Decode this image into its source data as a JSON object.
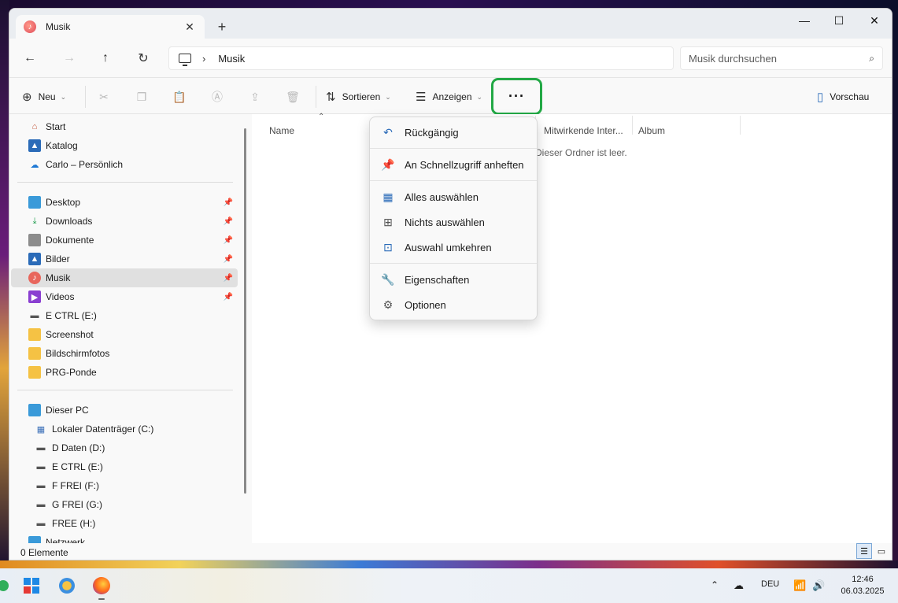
{
  "window": {
    "tab_title": "Musik",
    "new_tab": "+",
    "minimize": "—",
    "maximize": "☐",
    "close": "✕"
  },
  "nav": {
    "back": "←",
    "forward": "→",
    "up": "↑",
    "refresh": "↻",
    "breadcrumb": "Musik",
    "search_placeholder": "Musik durchsuchen"
  },
  "toolbar": {
    "new_label": "Neu",
    "sort_label": "Sortieren",
    "view_label": "Anzeigen",
    "more_label": "···",
    "preview_label": "Vorschau"
  },
  "sidebar": {
    "quick": [
      {
        "label": "Start"
      },
      {
        "label": "Katalog"
      },
      {
        "label": "Carlo – Persönlich"
      }
    ],
    "pinned": [
      {
        "label": "Desktop"
      },
      {
        "label": "Downloads"
      },
      {
        "label": "Dokumente"
      },
      {
        "label": "Bilder"
      },
      {
        "label": "Musik"
      },
      {
        "label": "Videos"
      },
      {
        "label": "E CTRL (E:)"
      },
      {
        "label": "Screenshot"
      },
      {
        "label": "Bildschirmfotos"
      },
      {
        "label": "PRG-Ponde"
      }
    ],
    "pc": [
      {
        "label": "Dieser PC"
      },
      {
        "label": "Lokaler Datenträger (C:)"
      },
      {
        "label": "D Daten  (D:)"
      },
      {
        "label": "E CTRL (E:)"
      },
      {
        "label": "F FREI (F:)"
      },
      {
        "label": "G FREI (G:)"
      },
      {
        "label": "FREE (H:)"
      },
      {
        "label": "Netzwerk"
      }
    ]
  },
  "columns": {
    "name": "Name",
    "contributors": "Mitwirkende Inter...",
    "album": "Album"
  },
  "empty_text": "Dieser Ordner ist leer.",
  "status": {
    "count": "0 Elemente"
  },
  "menu": {
    "items": [
      {
        "label": "Rückgängig",
        "icon": "undo-icon"
      },
      {
        "label": "An Schnellzugriff anheften",
        "icon": "pin-icon"
      },
      {
        "label": "Alles auswählen",
        "icon": "select-all-icon"
      },
      {
        "label": "Nichts auswählen",
        "icon": "select-none-icon"
      },
      {
        "label": "Auswahl umkehren",
        "icon": "invert-selection-icon"
      },
      {
        "label": "Eigenschaften",
        "icon": "wrench-icon"
      },
      {
        "label": "Optionen",
        "icon": "gear-icon"
      }
    ]
  },
  "taskbar": {
    "lang": "DEU",
    "time": "12:46",
    "date": "06.03.2025"
  },
  "colors": {
    "highlight": "#22a845",
    "accent": "#2b6bb8"
  }
}
